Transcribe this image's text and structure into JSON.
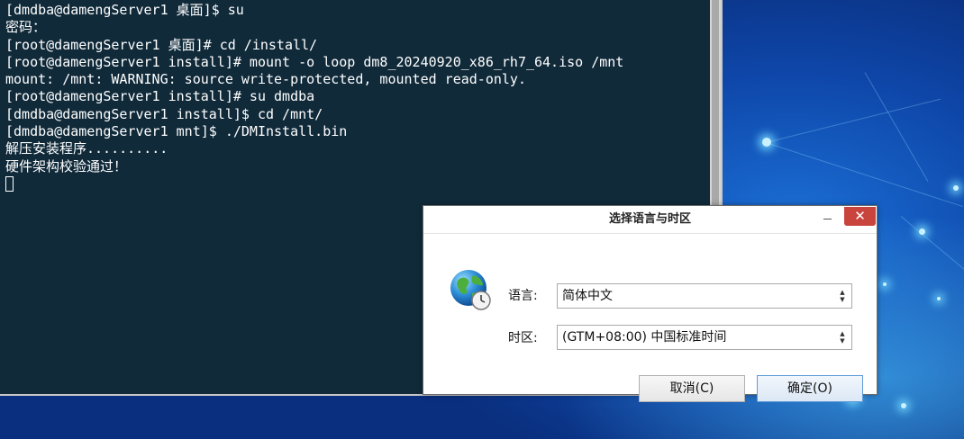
{
  "terminal": {
    "lines": [
      "[dmdba@damengServer1 桌面]$ su",
      "密码：",
      "[root@damengServer1 桌面]# cd /install/",
      "[root@damengServer1 install]# mount -o loop dm8_20240920_x86_rh7_64.iso /mnt",
      "mount: /mnt: WARNING: source write-protected, mounted read-only.",
      "[root@damengServer1 install]# su dmdba",
      "[dmdba@damengServer1 install]$ cd /mnt/",
      "[dmdba@damengServer1 mnt]$ ./DMInstall.bin",
      "解压安装程序..........",
      "硬件架构校验通过！"
    ]
  },
  "dialog": {
    "title": "选择语言与时区",
    "close_glyph": "✕",
    "language_label": "语言:",
    "language_value": "简体中文",
    "timezone_label": "时区:",
    "timezone_value": "(GTM+08:00) 中国标准时间",
    "cancel_label": "取消(C)",
    "ok_label": "确定(O)",
    "icon": "globe-clock-icon"
  },
  "colors": {
    "terminal_bg": "#102a3a",
    "close_button": "#c9443d",
    "desktop": "#0e46a8"
  }
}
